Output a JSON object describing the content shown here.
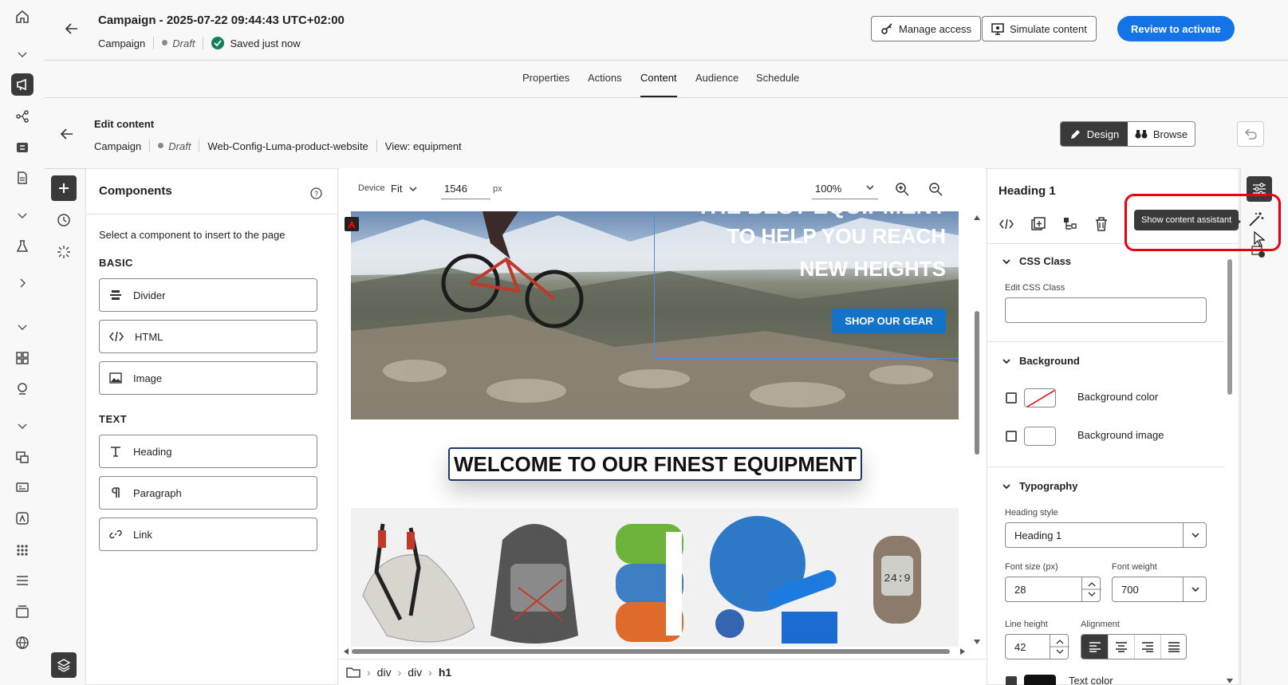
{
  "header": {
    "title": "Campaign - 2025-07-22 09:44:43 UTC+02:00",
    "type_label": "Campaign",
    "status": "Draft",
    "saved": "Saved just now",
    "manage_access": "Manage access",
    "simulate": "Simulate content",
    "review": "Review to activate"
  },
  "tabs": [
    "Properties",
    "Actions",
    "Content",
    "Audience",
    "Schedule"
  ],
  "edit": {
    "title": "Edit content",
    "crumb_campaign": "Campaign",
    "crumb_status": "Draft",
    "crumb_config": "Web-Config-Luma-product-website",
    "crumb_view": "View: equipment",
    "design": "Design",
    "browse": "Browse"
  },
  "components": {
    "title": "Components",
    "hint": "Select a component to insert to the page",
    "basic_label": "BASIC",
    "basic": [
      "Divider",
      "HTML",
      "Image"
    ],
    "text_label": "TEXT",
    "text": [
      "Heading",
      "Paragraph",
      "Link"
    ]
  },
  "canvas_toolbar": {
    "device_label": "Device",
    "device_value": "Fit",
    "width_value": "1546",
    "width_unit": "px",
    "zoom": "100%"
  },
  "canvas": {
    "hero_partial": "THE BEST EQUIPMENT",
    "hero_line1": "TO HELP YOU REACH",
    "hero_line2": "NEW HEIGHTS",
    "hero_button": "SHOP OUR GEAR",
    "heading": "WELCOME TO OUR FINEST EQUIPMENT"
  },
  "breadcrumb": [
    "div",
    "div",
    "h1"
  ],
  "props": {
    "title": "Heading 1",
    "tooltip": "Show content assistant",
    "css_section": "CSS Class",
    "css_label": "Edit CSS Class",
    "css_value": "",
    "bg_section": "Background",
    "bg_color": "Background color",
    "bg_image": "Background image",
    "typo_section": "Typography",
    "heading_style_label": "Heading style",
    "heading_style": "Heading 1",
    "font_size_label": "Font size (px)",
    "font_size": "28",
    "font_weight_label": "Font weight",
    "font_weight": "700",
    "line_height_label": "Line height",
    "line_height": "42",
    "alignment_label": "Alignment",
    "text_color_label": "Text color"
  },
  "colors": {
    "accent": "#1473e6",
    "highlight": "#e8000e",
    "dark": "#3a3a3a",
    "banner_button": "#1473c8"
  }
}
